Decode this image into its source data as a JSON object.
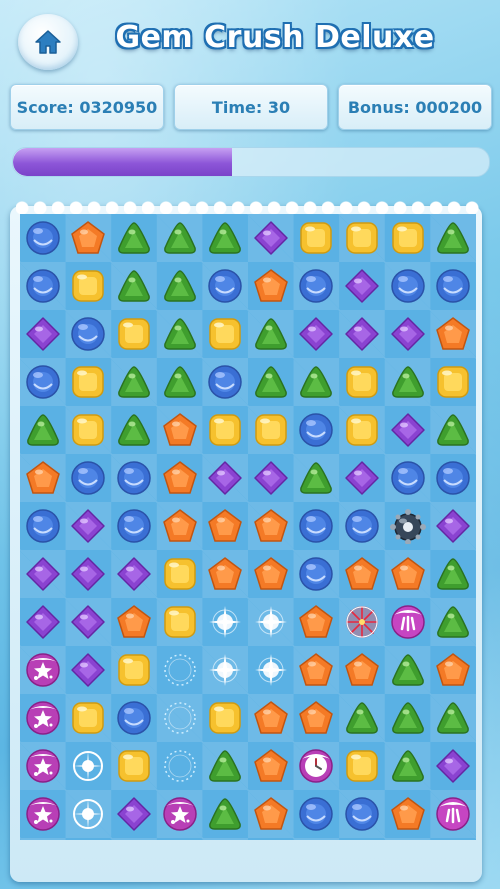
{
  "header": {
    "title": "Gem Crush Deluxe"
  },
  "stats": {
    "score_label": "Score: 0320950",
    "time_label": "Time: 30",
    "bonus_label": "Bonus: 000200"
  },
  "progress": {
    "value_pct": 46
  },
  "colors": {
    "blue": "#3a6fd4",
    "orange": "#f47a26",
    "green": "#3f9e2e",
    "purple": "#8a43d1",
    "yellow": "#f6c12e",
    "progress": "#8d56d8"
  },
  "board": {
    "cols": 10,
    "rows": 13,
    "grid": [
      [
        "blue",
        "orange",
        "green",
        "green",
        "green",
        "purple",
        "yellow",
        "yellow",
        "yellow",
        "green"
      ],
      [
        "blue",
        "yellow",
        "green",
        "green",
        "blue",
        "orange",
        "blue",
        "purple",
        "blue",
        "blue"
      ],
      [
        "purple",
        "blue",
        "yellow",
        "green",
        "yellow",
        "green",
        "purple",
        "purple",
        "purple",
        "orange"
      ],
      [
        "blue",
        "yellow",
        "green",
        "green",
        "blue",
        "green",
        "green",
        "yellow",
        "green",
        "yellow"
      ],
      [
        "green",
        "yellow",
        "green",
        "orange",
        "yellow",
        "yellow",
        "blue",
        "yellow",
        "purple",
        "green"
      ],
      [
        "orange",
        "blue",
        "blue",
        "orange",
        "purple",
        "purple",
        "green",
        "purple",
        "blue",
        "blue"
      ],
      [
        "blue",
        "purple",
        "blue",
        "orange",
        "orange",
        "orange",
        "blue",
        "blue",
        "bomb",
        "purple"
      ],
      [
        "purple",
        "purple",
        "purple",
        "yellow",
        "orange",
        "orange",
        "blue",
        "orange",
        "orange",
        "green"
      ],
      [
        "purple",
        "purple",
        "orange",
        "yellow",
        "spark",
        "spark",
        "orange",
        "firework",
        "snowball",
        "green"
      ],
      [
        "star",
        "purple",
        "yellow",
        "ring",
        "spark",
        "spark",
        "orange",
        "orange",
        "green",
        "orange"
      ],
      [
        "star",
        "yellow",
        "blue",
        "ring",
        "yellow",
        "orange",
        "orange",
        "green",
        "green",
        "green"
      ],
      [
        "star",
        "flare",
        "yellow",
        "ring",
        "green",
        "orange",
        "clock",
        "yellow",
        "green",
        "purple"
      ],
      [
        "star",
        "flare",
        "purple",
        "star",
        "green",
        "orange",
        "blue",
        "blue",
        "orange",
        "snowball"
      ]
    ]
  }
}
